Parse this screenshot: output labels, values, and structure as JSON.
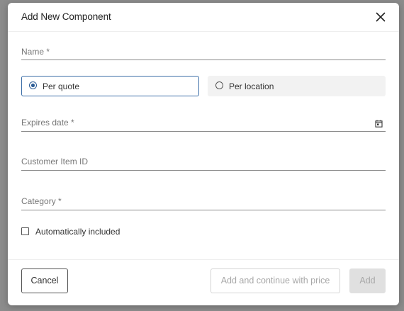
{
  "dialog": {
    "title": "Add New Component",
    "close_icon": "close-icon"
  },
  "fields": {
    "name_label": "Name *",
    "name_value": "",
    "expires_label": "Expires date *",
    "expires_value": "",
    "calendar_icon": "calendar-icon",
    "customer_item_label": "Customer Item ID",
    "customer_item_value": "",
    "category_label": "Category *",
    "category_value": ""
  },
  "pricing_mode": {
    "options": [
      {
        "label": "Per quote",
        "selected": true
      },
      {
        "label": "Per location",
        "selected": false
      }
    ]
  },
  "automatically_included": {
    "label": "Automatically included",
    "checked": false
  },
  "footer": {
    "cancel_label": "Cancel",
    "continue_label": "Add and continue with price",
    "add_label": "Add"
  },
  "colors": {
    "accent": "#2c5d96",
    "disabled_text": "#a8a8a8",
    "disabled_bg": "#e0e0e0"
  }
}
